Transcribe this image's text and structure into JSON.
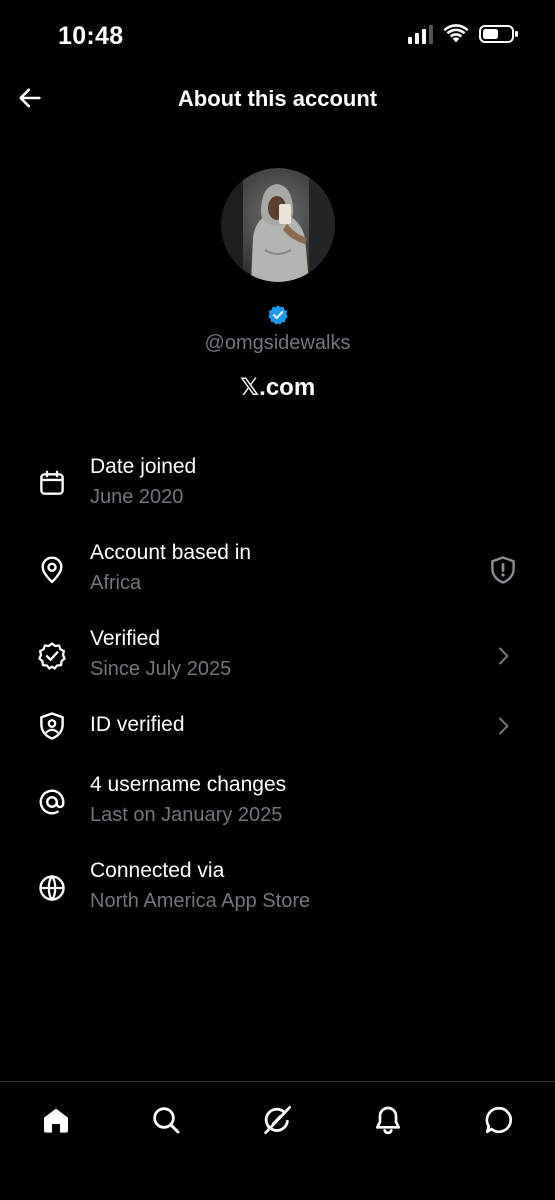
{
  "status_bar": {
    "time": "10:48",
    "icons": [
      "signal-icon",
      "wifi-icon",
      "battery-icon"
    ]
  },
  "header": {
    "title": "About this account",
    "back_icon": "back-arrow-icon"
  },
  "profile": {
    "handle": "@omgsidewalks",
    "site": "𝕏.com",
    "verified": true,
    "verified_color": "#1d9bf0"
  },
  "info_rows": [
    {
      "icon": "calendar-icon",
      "title": "Date joined",
      "subtitle": "June 2020",
      "trailing": ""
    },
    {
      "icon": "location-pin-icon",
      "title": "Account based in",
      "subtitle": "Africa",
      "trailing": "shield-alert-icon"
    },
    {
      "icon": "verified-badge-outline-icon",
      "title": "Verified",
      "subtitle": "Since July 2025",
      "trailing": "chevron-right-icon"
    },
    {
      "icon": "id-shield-icon",
      "title": "ID verified",
      "subtitle": "",
      "trailing": "chevron-right-icon"
    },
    {
      "icon": "at-sign-icon",
      "title": "4 username changes",
      "subtitle": "Last on January 2025",
      "trailing": ""
    },
    {
      "icon": "globe-icon",
      "title": "Connected via",
      "subtitle": "North America App Store",
      "trailing": ""
    }
  ],
  "bottom_nav": [
    "home-icon",
    "search-icon",
    "grok-icon",
    "notifications-bell-icon",
    "messages-icon"
  ],
  "colors": {
    "background": "#000000",
    "text_primary": "#ffffff",
    "text_secondary": "#71767b",
    "accent": "#1d9bf0",
    "divider": "#2f3336"
  }
}
